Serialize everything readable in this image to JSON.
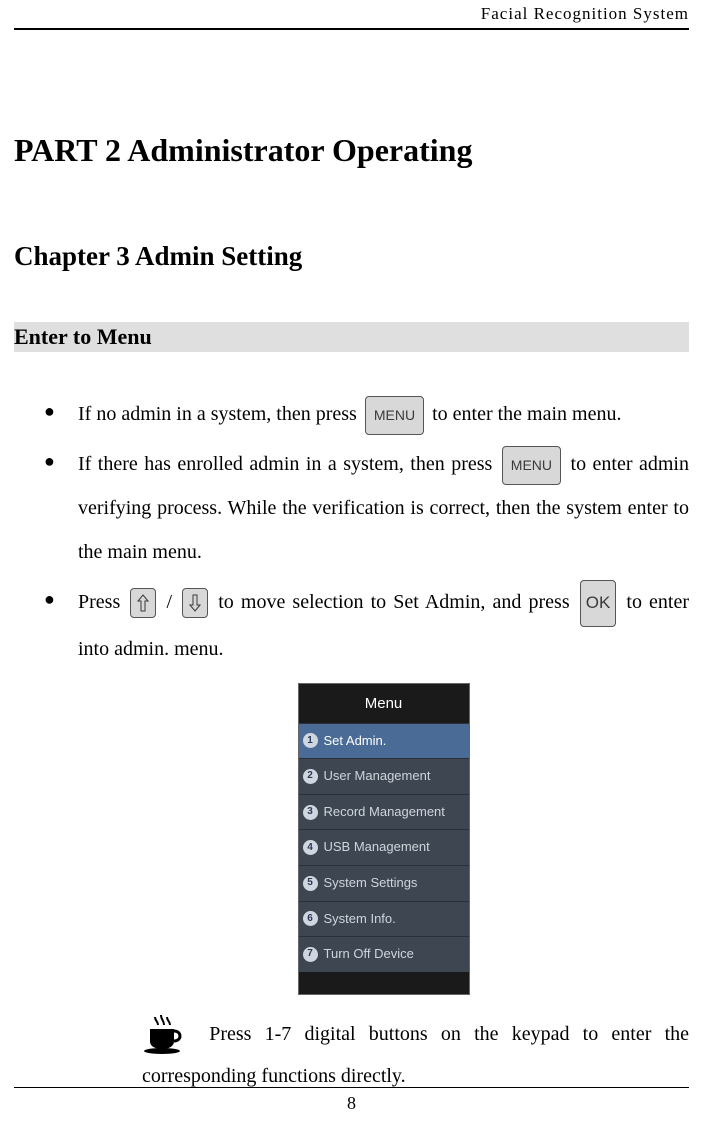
{
  "header": "Facial  Recognition  System",
  "part_title": "PART 2    Administrator Operating",
  "chapter_title": "Chapter 3 Admin Setting",
  "section_title": "Enter to Menu",
  "bullets": {
    "b1_a": "If no admin in a system, then press ",
    "b1_b": " to enter the main menu.",
    "b2_a": "If  there  has  enrolled  admin  in  a  system,  then  press ",
    "b2_b": "  to  enter admin  verifying  process.  While  the  verification  is  correct,  then  the system enter to the main menu.",
    "b3_a": "Press ",
    "b3_b": " / ",
    "b3_c": "  to  move  selection  to  Set  Admin,  and  press ",
    "b3_d": "  to enter into admin. menu."
  },
  "menu_button_label": "MENU",
  "ok_button_label": "OK",
  "device_menu": {
    "title": "Menu",
    "items": [
      "Set Admin.",
      "User Management",
      "Record Management",
      "USB Management",
      "System Settings",
      "System Info.",
      "Turn Off Device"
    ]
  },
  "tip_text_a": "  Press 1-7 digital buttons on the keypad to enter the corresponding functions directly.",
  "page_number": "8"
}
